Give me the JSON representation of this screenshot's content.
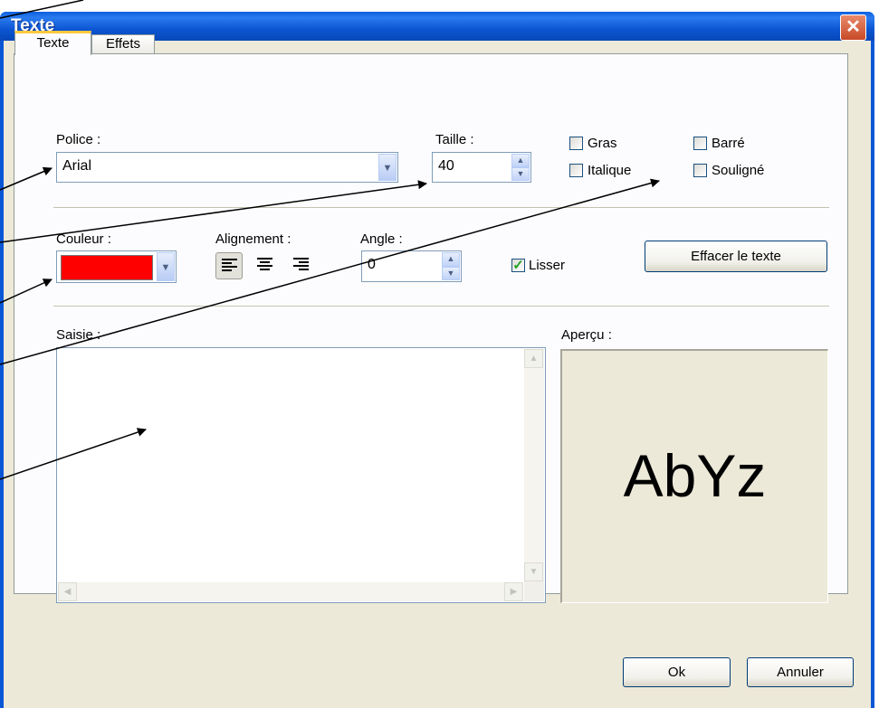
{
  "window": {
    "title": "Texte",
    "close_glyph": "✕"
  },
  "tabs": [
    {
      "label": "Texte",
      "active": true
    },
    {
      "label": "Effets",
      "active": false
    }
  ],
  "font": {
    "label": "Police :",
    "value": "Arial"
  },
  "size": {
    "label": "Taille :",
    "value": "40"
  },
  "style_options": [
    {
      "label": "Gras",
      "checked": false
    },
    {
      "label": "Barré",
      "checked": false
    },
    {
      "label": "Italique",
      "checked": false
    },
    {
      "label": "Souligné",
      "checked": false
    }
  ],
  "color": {
    "label": "Couleur :",
    "value": "#ff0000"
  },
  "alignment": {
    "label": "Alignement :",
    "options": [
      "left",
      "center",
      "right"
    ],
    "selected": "left"
  },
  "angle": {
    "label": "Angle :",
    "value": "0"
  },
  "smooth": {
    "label": "Lisser",
    "checked": true
  },
  "clear_button": "Effacer le texte",
  "input": {
    "label": "Saisie :",
    "value": ""
  },
  "preview": {
    "label": "Aperçu :",
    "sample": "AbYz"
  },
  "buttons": {
    "ok": "Ok",
    "cancel": "Annuler"
  },
  "icons": {
    "dropdown": "chevron-down-icon",
    "spin_up": "chevron-up-icon",
    "spin_down": "chevron-down-icon",
    "check": "✓"
  }
}
